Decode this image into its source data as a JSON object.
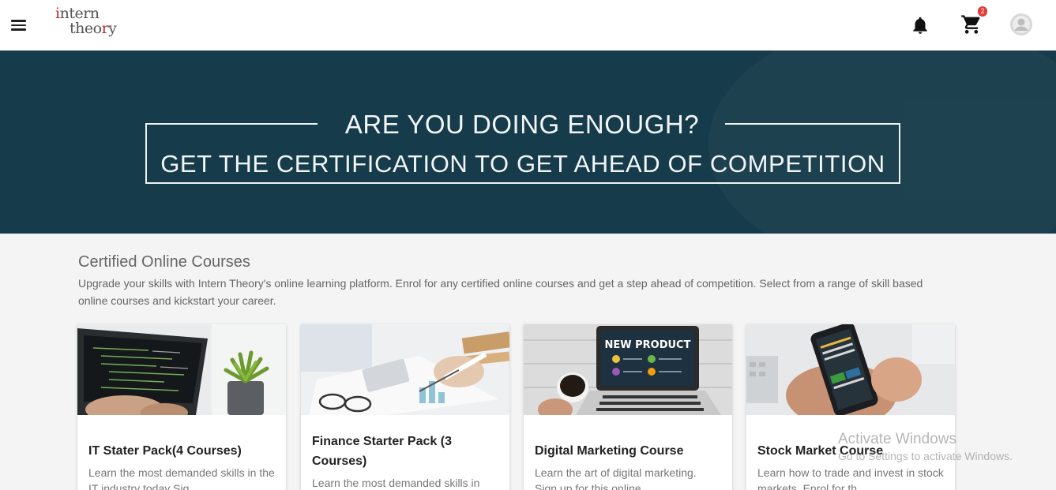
{
  "header": {
    "logo_line1": {
      "a": "i",
      "b": "ntern"
    },
    "logo_line2": {
      "a": "theo",
      "b": "r",
      "c": "y"
    },
    "cart_count": "2",
    "icons": {
      "menu": "hamburger-menu-icon",
      "bell": "bell-icon",
      "cart": "shopping-cart-icon",
      "avatar": "user-avatar-icon"
    }
  },
  "hero": {
    "line1": "ARE YOU DOING ENOUGH?",
    "line2": "GET THE CERTIFICATION TO GET AHEAD OF COMPETITION",
    "colors": {
      "background": "#163b4a",
      "text": "#f1f5f7"
    }
  },
  "section": {
    "title": "Certified Online Courses",
    "description": "Upgrade your skills with Intern Theory's online learning platform. Enrol for any certified online courses and get a step ahead of competition. Select from a range of skill based online courses and kickstart your career."
  },
  "courses": [
    {
      "title": "IT Stater Pack(4 Courses)",
      "description": "Learn the most demanded skills in the IT industry today Sig"
    },
    {
      "title": "Finance Starter Pack (3 Courses)",
      "description": "Learn the most demanded skills in"
    },
    {
      "title": "Digital Marketing Course",
      "description": "Learn the art of digital marketing. Sign up for this online",
      "image_text": "NEW PRODUCT"
    },
    {
      "title": "Stock Market Course",
      "description": "Learn how to trade and invest in stock markets. Enrol for th"
    }
  ],
  "watermark": {
    "line1": "Activate Windows",
    "line2": "Go to Settings to activate Windows."
  }
}
